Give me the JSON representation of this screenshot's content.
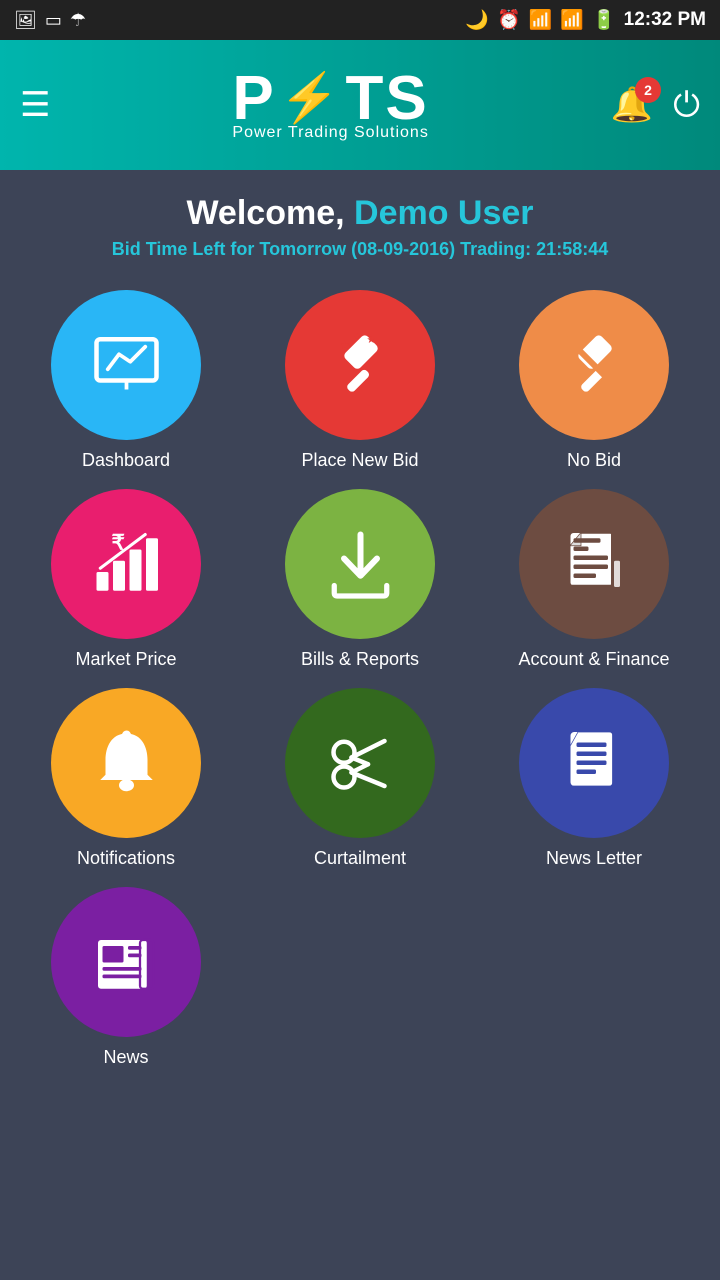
{
  "statusBar": {
    "time": "12:32 PM"
  },
  "header": {
    "logoMain": "PTS",
    "logoSub": "Power Trading Solutions",
    "bellBadge": "2"
  },
  "welcome": {
    "prefix": "Welcome,",
    "username": "Demo User",
    "bidLabel": "Bid Time Left for Tomorrow (08-09-2016) Trading:",
    "bidTime": "21:58:44"
  },
  "grid": {
    "items": [
      {
        "id": "dashboard",
        "label": "Dashboard",
        "color": "bg-blue"
      },
      {
        "id": "place-new-bid",
        "label": "Place New Bid",
        "color": "bg-red"
      },
      {
        "id": "no-bid",
        "label": "No Bid",
        "color": "bg-orange"
      },
      {
        "id": "market-price",
        "label": "Market Price",
        "color": "bg-pink"
      },
      {
        "id": "bills-reports",
        "label": "Bills & Reports",
        "color": "bg-green"
      },
      {
        "id": "account-finance",
        "label": "Account & Finance",
        "color": "bg-brown"
      },
      {
        "id": "notifications",
        "label": "Notifications",
        "color": "bg-amber"
      },
      {
        "id": "curtailment",
        "label": "Curtailment",
        "color": "bg-darkgreen"
      },
      {
        "id": "news-letter",
        "label": "News Letter",
        "color": "bg-indigo"
      },
      {
        "id": "news",
        "label": "News",
        "color": "bg-purple"
      }
    ]
  }
}
